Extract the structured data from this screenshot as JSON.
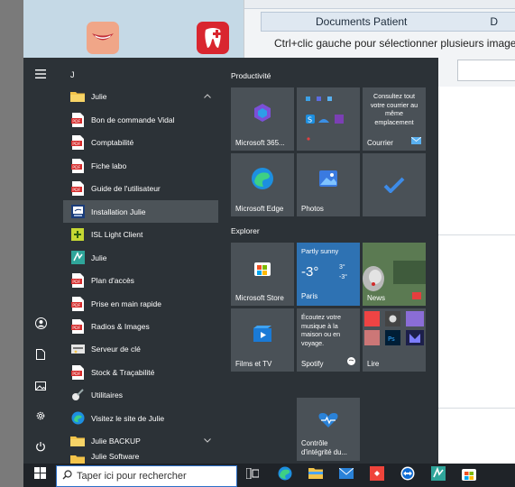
{
  "app_window": {
    "header_col1": "Documents Patient",
    "header_col2": "D",
    "hint": "Ctrl+clic gauche pour sélectionner plusieurs images"
  },
  "start_menu": {
    "letter": "J",
    "apps": [
      {
        "label": "Julie",
        "icon": "folder-icon",
        "expanded": true
      },
      {
        "label": "Bon de commande Vidal",
        "icon": "pdf-icon"
      },
      {
        "label": "Comptabilité",
        "icon": "pdf-icon"
      },
      {
        "label": "Fiche labo",
        "icon": "pdf-icon"
      },
      {
        "label": "Guide de l'utilisateur",
        "icon": "pdf-icon"
      },
      {
        "label": "Installation Julie",
        "icon": "installer-icon",
        "selected": true
      },
      {
        "label": "ISL Light Client",
        "icon": "isl-icon"
      },
      {
        "label": "Julie",
        "icon": "julie-app-icon"
      },
      {
        "label": "Plan d'accès",
        "icon": "pdf-icon"
      },
      {
        "label": "Prise en main rapide",
        "icon": "pdf-icon"
      },
      {
        "label": "Radios & Images",
        "icon": "pdf-icon"
      },
      {
        "label": "Serveur de clé",
        "icon": "key-server-icon"
      },
      {
        "label": "Stock & Traçabilité",
        "icon": "pdf-icon"
      },
      {
        "label": "Utilitaires",
        "icon": "utilities-icon"
      },
      {
        "label": "Visitez le site de Julie",
        "icon": "edge-icon"
      },
      {
        "label": "Julie BACKUP",
        "icon": "folder-icon"
      },
      {
        "label": "Julie Software",
        "icon": "folder-icon"
      }
    ],
    "groups": {
      "productivity": "Productivité",
      "explorer": "Explorer"
    },
    "tiles": {
      "m365": "Microsoft 365...",
      "mail_text": "Consultez tout votre courrier au même emplacement",
      "mail": "Courrier",
      "edge": "Microsoft Edge",
      "photos": "Photos",
      "store": "Microsoft Store",
      "weather_cond": "Partly sunny",
      "weather_temp": "-3°",
      "weather_hi": "3°",
      "weather_lo": "-3°",
      "weather_city": "Paris",
      "news": "News",
      "movies": "Films et TV",
      "spotify_text": "Écoutez votre musique à la maison ou en voyage.",
      "spotify": "Spotify",
      "read": "Lire",
      "health": "Contrôle d'intégrité du..."
    }
  },
  "taskbar": {
    "search_placeholder": "Taper ici pour rechercher"
  },
  "colors": {
    "menu_bg": "#2c3237",
    "tile_bg": "#4a5157",
    "accent": "#2b6fc7",
    "pdf_red": "#d62d2d",
    "folder_yellow": "#f3c44a"
  }
}
